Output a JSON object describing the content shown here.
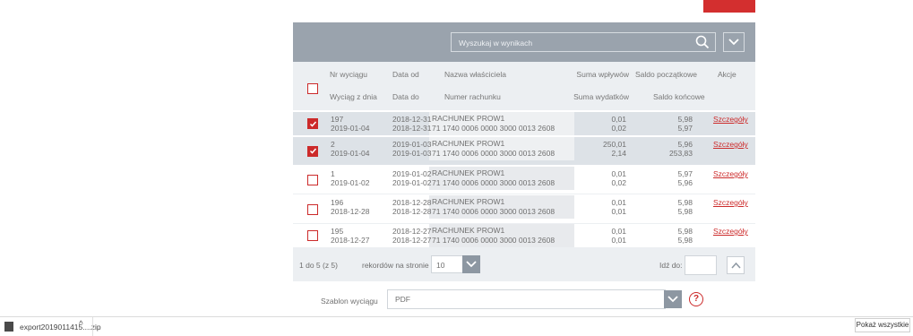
{
  "search": {
    "placeholder": "Wyszukaj w wynikach"
  },
  "columns": {
    "nr_wyciagu": "Nr wyciągu",
    "wyciag_z_dnia": "Wyciąg z dnia",
    "data_od": "Data od",
    "data_do": "Data do",
    "nazwa_wlasciciela": "Nazwa właściciela",
    "numer_rachunku": "Numer rachunku",
    "suma_wplywow": "Suma wpływów",
    "suma_wydatkow": "Suma wydatków",
    "saldo_poczatkowe": "Saldo początkowe",
    "saldo_koncowe": "Saldo końcowe",
    "akcje": "Akcje"
  },
  "rows": [
    {
      "checked": true,
      "nr": "197",
      "date": "2019-01-04",
      "from": "2018-12-31",
      "to": "2018-12-31",
      "name": "RACHUNEK PROW1",
      "account": "71 1740 0006 0000 3000 0013 2608",
      "in": "0,01",
      "out": "0,02",
      "saldo_start": "5,98",
      "saldo_end": "5,97",
      "action": "Szczegóły"
    },
    {
      "checked": true,
      "nr": "2",
      "date": "2019-01-04",
      "from": "2019-01-03",
      "to": "2019-01-03",
      "name": "RACHUNEK PROW1",
      "account": "71 1740 0006 0000 3000 0013 2608",
      "in": "250,01",
      "out": "2,14",
      "saldo_start": "5,96",
      "saldo_end": "253,83",
      "action": "Szczegóły"
    },
    {
      "checked": false,
      "nr": "1",
      "date": "2019-01-02",
      "from": "2019-01-02",
      "to": "2019-01-02",
      "name": "RACHUNEK PROW1",
      "account": "71 1740 0006 0000 3000 0013 2608",
      "in": "0,01",
      "out": "0,02",
      "saldo_start": "5,97",
      "saldo_end": "5,96",
      "action": "Szczegóły"
    },
    {
      "checked": false,
      "nr": "196",
      "date": "2018-12-28",
      "from": "2018-12-28",
      "to": "2018-12-28",
      "name": "RACHUNEK PROW1",
      "account": "71 1740 0006 0000 3000 0013 2608",
      "in": "0,01",
      "out": "0,01",
      "saldo_start": "5,98",
      "saldo_end": "5,98",
      "action": "Szczegóły"
    },
    {
      "checked": false,
      "nr": "195",
      "date": "2018-12-27",
      "from": "2018-12-27",
      "to": "2018-12-27",
      "name": "RACHUNEK PROW1",
      "account": "71 1740 0006 0000 3000 0013 2608",
      "in": "0,01",
      "out": "0,01",
      "saldo_start": "5,98",
      "saldo_end": "5,98",
      "action": "Szczegóły"
    }
  ],
  "footer": {
    "range": "1 do 5 (z 5)",
    "per_page_label": "rekordów na stronie",
    "per_page_value": "10",
    "goto_label": "Idź do:"
  },
  "template": {
    "label": "Szablon wyciągu",
    "value": "PDF",
    "help": "?"
  },
  "downloads": {
    "file": "export2019011415....zip",
    "show_all": "Pokaż wszystkie"
  },
  "colors": {
    "accent": "#cc2a2a",
    "toolbar": "#9aa3ad",
    "header_bg": "#eceff2",
    "selected_row": "#dde2e7"
  },
  "icons": {
    "search": "search-icon",
    "dropdown": "chevron-down-icon",
    "up": "chevron-up-icon",
    "help": "help-icon",
    "file": "zip-file-icon"
  }
}
